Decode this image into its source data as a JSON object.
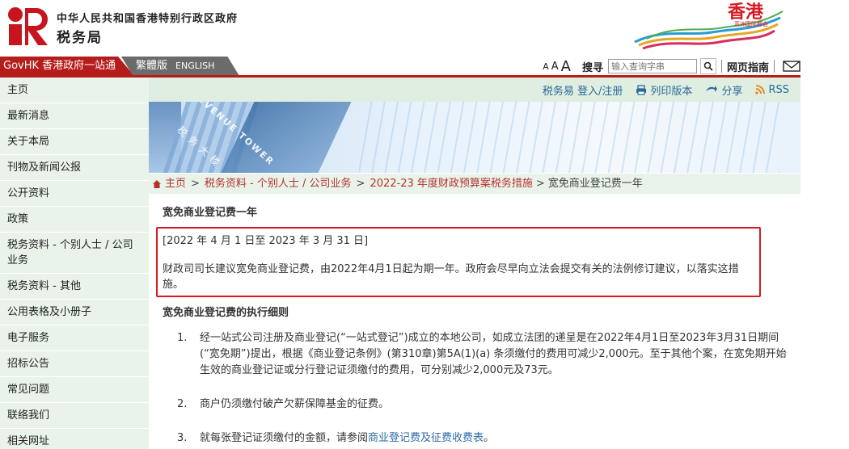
{
  "header": {
    "dept_top": "中华人民共和国香港特别行政区政府",
    "dept_name": "税务局",
    "brand_text": "香港",
    "brand_sub": "亚洲国际都会"
  },
  "topbar": {
    "govhk_label": "GovHK 香港政府一站通",
    "lang_trad": "繁體版",
    "lang_en": "ENGLISH",
    "font_small": "A",
    "font_medium": "A",
    "font_large": "A",
    "search_label": "搜寻",
    "search_placeholder": "输入查询字串",
    "sitemap_label": "网页指南"
  },
  "sidebar": {
    "items": [
      {
        "label": "主页"
      },
      {
        "label": "最新消息"
      },
      {
        "label": "关于本局"
      },
      {
        "label": "刊物及新闻公报"
      },
      {
        "label": "公开资料"
      },
      {
        "label": "政策"
      },
      {
        "label": "税务资料 - 个别人士 / 公司业务"
      },
      {
        "label": "税务资料 - 其他"
      },
      {
        "label": "公用表格及小册子"
      },
      {
        "label": "电子服务"
      },
      {
        "label": "招标公告"
      },
      {
        "label": "常见问题"
      },
      {
        "label": "联络我们"
      },
      {
        "label": "相关网址"
      }
    ]
  },
  "utilbar": {
    "etax_label": "税务易 登入/注册",
    "print_label": "列印版本",
    "share_label": "分享",
    "rss_label": "RSS"
  },
  "banner": {
    "text1": "REVENUE TOWER",
    "text2": "税务大楼"
  },
  "breadcrumb": {
    "home": "主页",
    "level1": "税务资料 - 个别人士 / 公司业务",
    "level2": "2022-23 年度财政预算案税务措施",
    "current": "宽免商业登记费一年"
  },
  "content": {
    "title": "宽免商业登记费一年",
    "notice_dates": "[2022 年 4 月 1 日至 2023 年 3 月 31 日]",
    "notice_text": "财政司司长建议宽免商业登记费，由2022年4月1日起为期一年。政府会尽早向立法会提交有关的法例修订建议，以落实这措施。",
    "section_title": "宽免商业登记费的执行细则",
    "steps": [
      {
        "num": "1.",
        "text": "经一站式公司注册及商业登记(“一站式登记”)成立的本地公司，如成立法团的递呈是在2022年4月1日至2023年3月31日期间(“宽免期”)提出，根据《商业登记条例》(第310章)第5A(1)(a) 条须缴付的费用可减少2,000元。至于其他个案，在宽免期开始生效的商业登记证或分行登记证须缴付的费用，可分别减少2,000元及73元。"
      },
      {
        "num": "2.",
        "text": "商户仍须缴付破产欠薪保障基金的征费。"
      },
      {
        "num": "3.",
        "text_before": "就每张登记证须缴付的金额，请参阅",
        "link": "商业登记费及征费收费表",
        "text_after": "。"
      }
    ]
  },
  "colors": {
    "accent_red": "#b51d1b",
    "sidebar_bg": "#e9f3ea",
    "link_blue": "#2a6a9a",
    "notice_border": "#d71920"
  }
}
